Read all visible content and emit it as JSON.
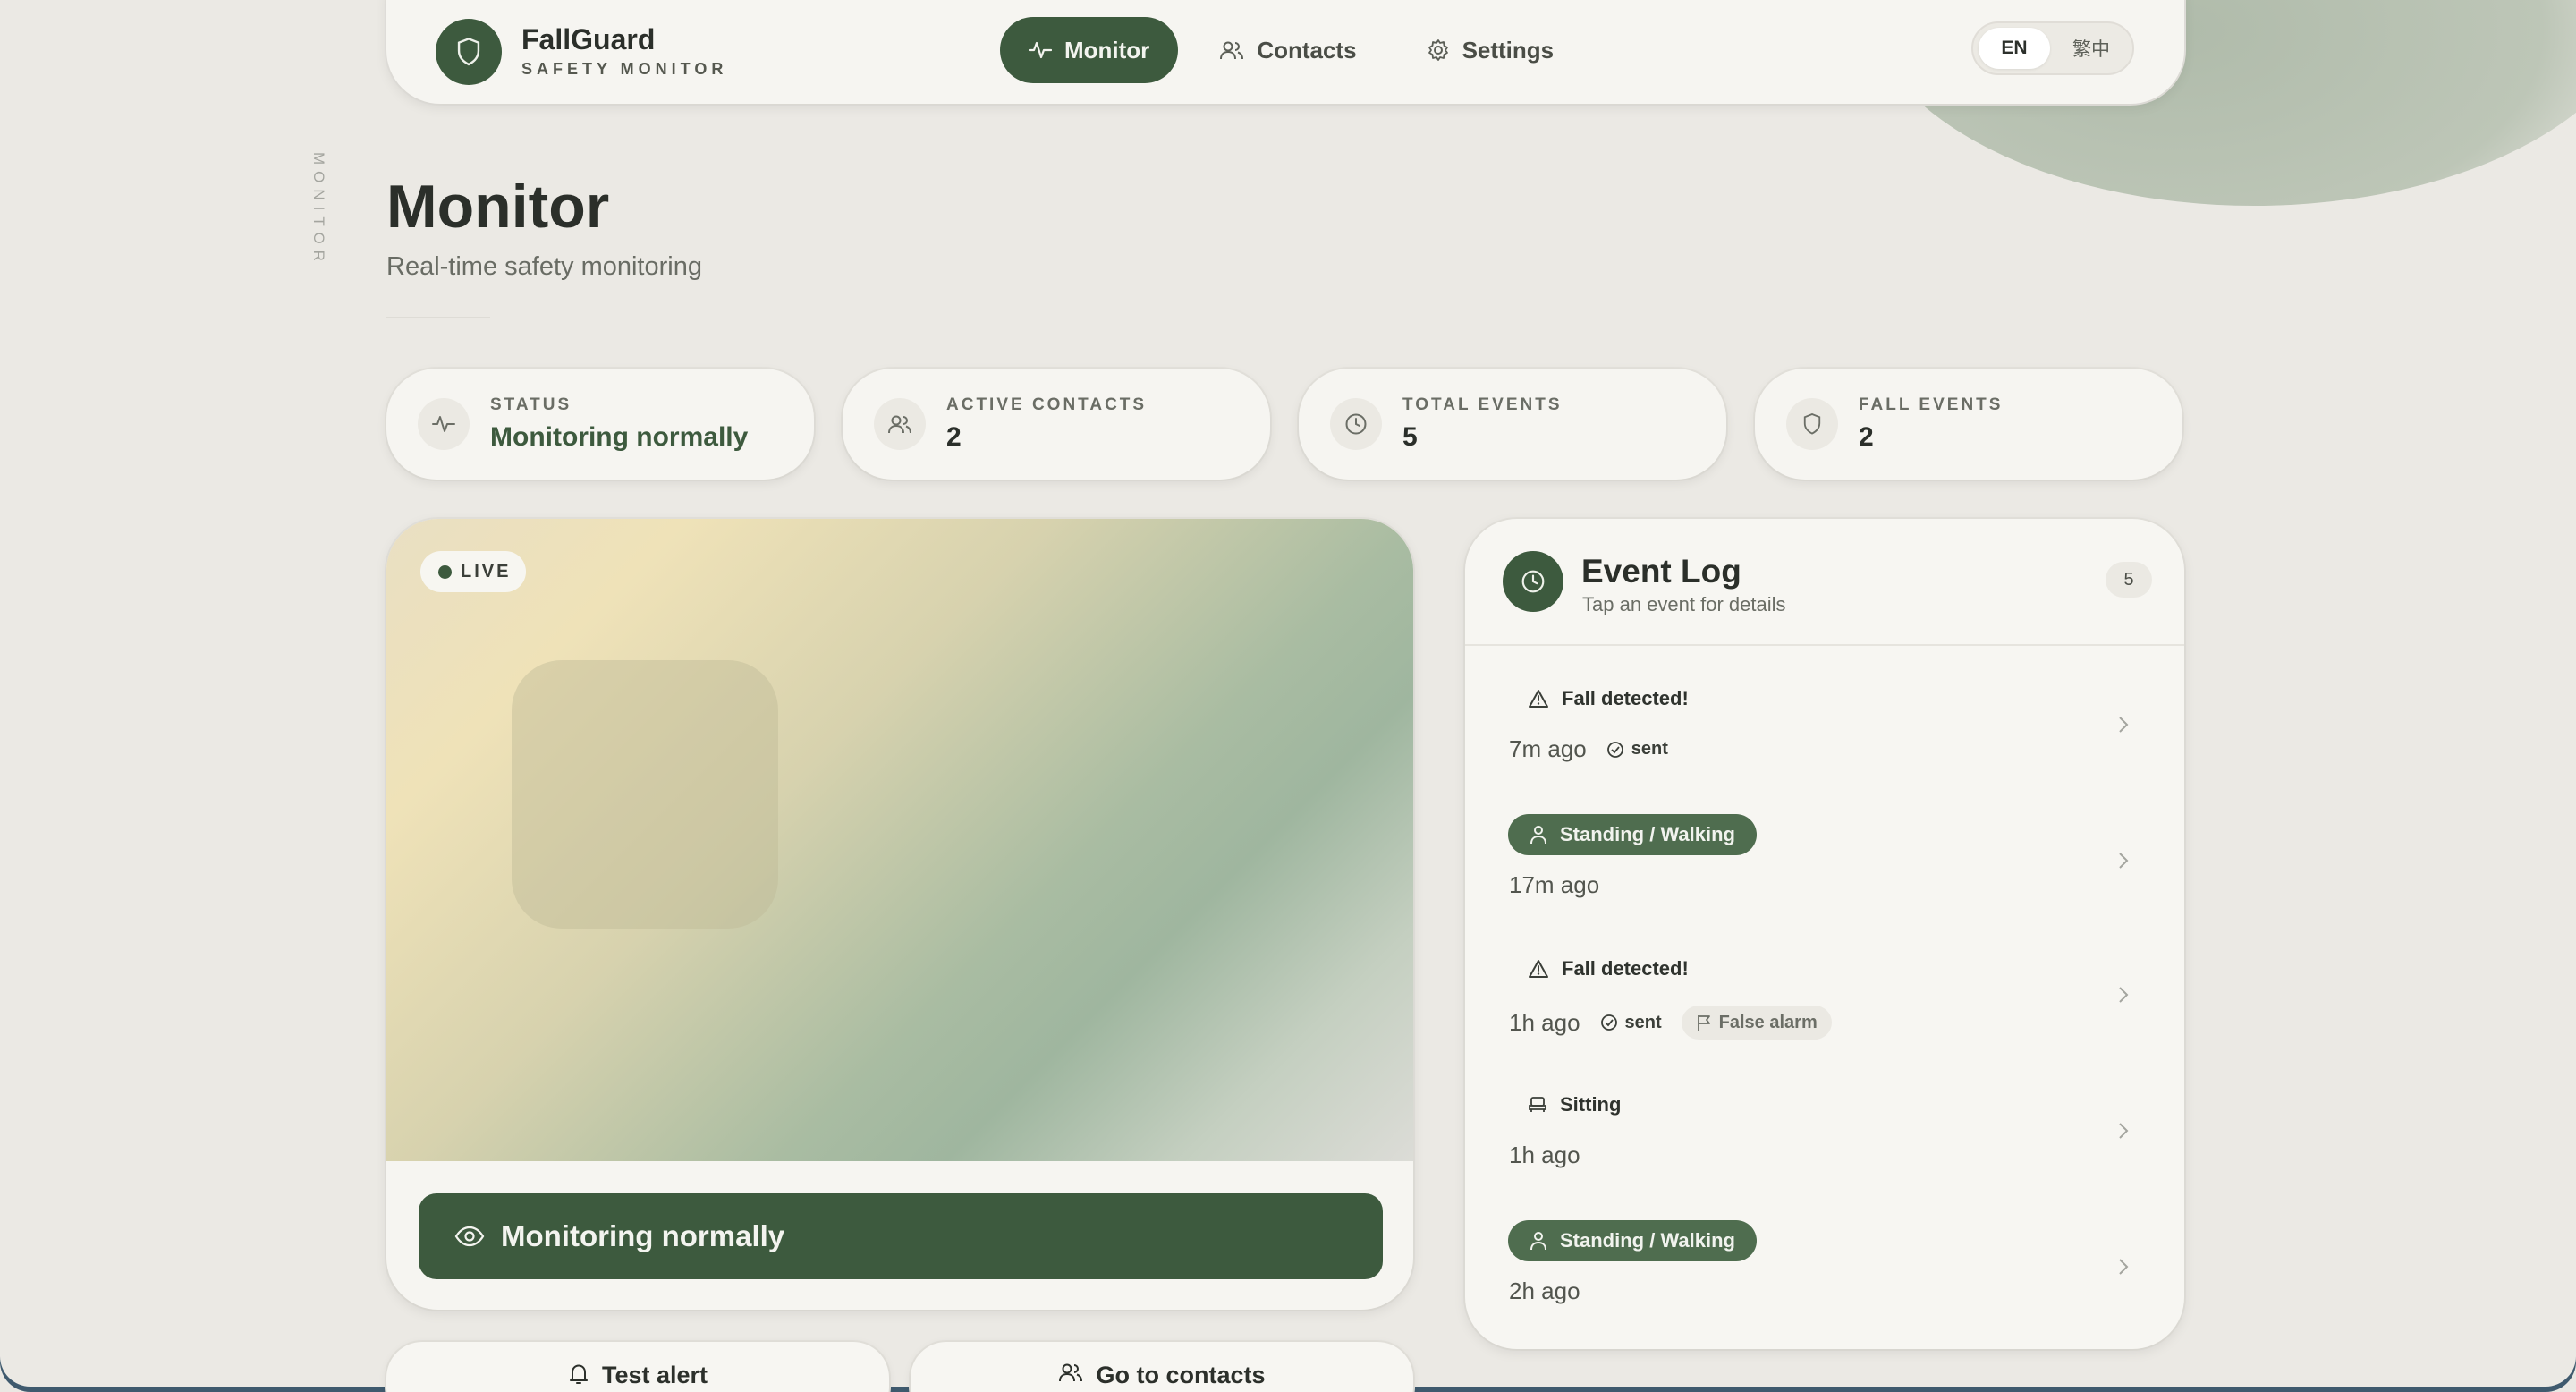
{
  "app": {
    "brand_name": "FallGuard",
    "brand_sub": "SAFETY MONITOR",
    "side_label": "MONITOR"
  },
  "nav": {
    "items": [
      {
        "label": "Monitor",
        "icon": "activity-icon",
        "active": true
      },
      {
        "label": "Contacts",
        "icon": "users-icon",
        "active": false
      },
      {
        "label": "Settings",
        "icon": "gear-icon",
        "active": false
      }
    ],
    "lang": {
      "en": "EN",
      "zh": "繁中",
      "selected": "EN"
    }
  },
  "page": {
    "title": "Monitor",
    "subtitle": "Real-time safety monitoring"
  },
  "stats": [
    {
      "label": "STATUS",
      "value": "Monitoring normally",
      "icon": "activity-icon"
    },
    {
      "label": "ACTIVE CONTACTS",
      "value": "2",
      "icon": "users-icon"
    },
    {
      "label": "TOTAL EVENTS",
      "value": "5",
      "icon": "clock-icon"
    },
    {
      "label": "FALL EVENTS",
      "value": "2",
      "icon": "shield-icon"
    }
  ],
  "camera": {
    "live_label": "LIVE",
    "status_button": "Monitoring normally"
  },
  "event_log": {
    "title": "Event Log",
    "subtitle": "Tap an event for details",
    "count": "5",
    "events": [
      {
        "type": "Fall detected!",
        "time": "7m ago",
        "sent": "sent",
        "flag": ""
      },
      {
        "type": "Standing / Walking",
        "time": "17m ago",
        "sent": "",
        "flag": ""
      },
      {
        "type": "Fall detected!",
        "time": "1h ago",
        "sent": "sent",
        "flag": "False alarm"
      },
      {
        "type": "Sitting",
        "time": "1h ago",
        "sent": "",
        "flag": ""
      },
      {
        "type": "Standing / Walking",
        "time": "2h ago",
        "sent": "",
        "flag": ""
      }
    ]
  },
  "actions": {
    "test_alert": "Test alert",
    "go_contacts": "Go to contacts"
  },
  "colors": {
    "accent": "#3d5a3e",
    "background": "#ebe9e4",
    "card": "#f6f5f1"
  }
}
